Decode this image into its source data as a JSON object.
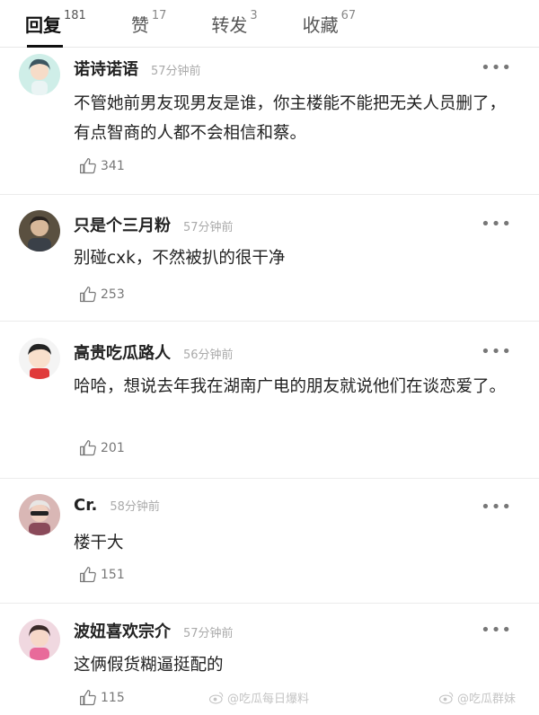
{
  "tabs": [
    {
      "label": "回复",
      "count": "181"
    },
    {
      "label": "赞",
      "count": "17"
    },
    {
      "label": "转发",
      "count": "3"
    },
    {
      "label": "收藏",
      "count": "67"
    }
  ],
  "comments": [
    {
      "user": "诺诗诺语",
      "time": "57分钟前",
      "text": "不管她前男友现男友是谁，你主楼能不能把无关人员删了，有点智商的人都不会相信和蔡。",
      "likes": "341"
    },
    {
      "user": "只是个三月粉",
      "time": "57分钟前",
      "text": "别碰cxk，不然被扒的很干净",
      "likes": "253"
    },
    {
      "user": "高贵吃瓜路人",
      "time": "56分钟前",
      "text": "哈哈，想说去年我在湖南广电的朋友就说他们在谈恋爱了。",
      "likes": "201"
    },
    {
      "user": "Cr.",
      "time": "58分钟前",
      "text": "楼干大",
      "likes": "151"
    },
    {
      "user": "波妞喜欢宗介",
      "time": "57分钟前",
      "text": "这俩假货糊逼挺配的",
      "likes": "115"
    }
  ],
  "more_label": "•••",
  "watermarks": [
    "@吃瓜每日爆料",
    "@吃瓜群妹"
  ],
  "colors": {
    "text": "#222222",
    "meta": "#aaaaaa",
    "divider": "#ececec"
  }
}
